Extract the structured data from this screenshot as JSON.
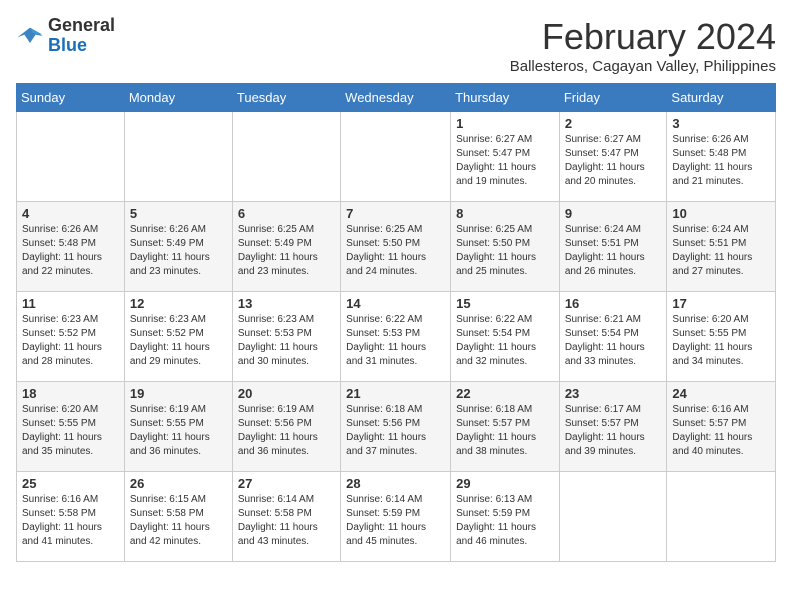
{
  "header": {
    "logo_general": "General",
    "logo_blue": "Blue",
    "title": "February 2024",
    "subtitle": "Ballesteros, Cagayan Valley, Philippines"
  },
  "weekdays": [
    "Sunday",
    "Monday",
    "Tuesday",
    "Wednesday",
    "Thursday",
    "Friday",
    "Saturday"
  ],
  "weeks": [
    [
      {
        "day": "",
        "info": ""
      },
      {
        "day": "",
        "info": ""
      },
      {
        "day": "",
        "info": ""
      },
      {
        "day": "",
        "info": ""
      },
      {
        "day": "1",
        "info": "Sunrise: 6:27 AM\nSunset: 5:47 PM\nDaylight: 11 hours and 19 minutes."
      },
      {
        "day": "2",
        "info": "Sunrise: 6:27 AM\nSunset: 5:47 PM\nDaylight: 11 hours and 20 minutes."
      },
      {
        "day": "3",
        "info": "Sunrise: 6:26 AM\nSunset: 5:48 PM\nDaylight: 11 hours and 21 minutes."
      }
    ],
    [
      {
        "day": "4",
        "info": "Sunrise: 6:26 AM\nSunset: 5:48 PM\nDaylight: 11 hours and 22 minutes."
      },
      {
        "day": "5",
        "info": "Sunrise: 6:26 AM\nSunset: 5:49 PM\nDaylight: 11 hours and 23 minutes."
      },
      {
        "day": "6",
        "info": "Sunrise: 6:25 AM\nSunset: 5:49 PM\nDaylight: 11 hours and 23 minutes."
      },
      {
        "day": "7",
        "info": "Sunrise: 6:25 AM\nSunset: 5:50 PM\nDaylight: 11 hours and 24 minutes."
      },
      {
        "day": "8",
        "info": "Sunrise: 6:25 AM\nSunset: 5:50 PM\nDaylight: 11 hours and 25 minutes."
      },
      {
        "day": "9",
        "info": "Sunrise: 6:24 AM\nSunset: 5:51 PM\nDaylight: 11 hours and 26 minutes."
      },
      {
        "day": "10",
        "info": "Sunrise: 6:24 AM\nSunset: 5:51 PM\nDaylight: 11 hours and 27 minutes."
      }
    ],
    [
      {
        "day": "11",
        "info": "Sunrise: 6:23 AM\nSunset: 5:52 PM\nDaylight: 11 hours and 28 minutes."
      },
      {
        "day": "12",
        "info": "Sunrise: 6:23 AM\nSunset: 5:52 PM\nDaylight: 11 hours and 29 minutes."
      },
      {
        "day": "13",
        "info": "Sunrise: 6:23 AM\nSunset: 5:53 PM\nDaylight: 11 hours and 30 minutes."
      },
      {
        "day": "14",
        "info": "Sunrise: 6:22 AM\nSunset: 5:53 PM\nDaylight: 11 hours and 31 minutes."
      },
      {
        "day": "15",
        "info": "Sunrise: 6:22 AM\nSunset: 5:54 PM\nDaylight: 11 hours and 32 minutes."
      },
      {
        "day": "16",
        "info": "Sunrise: 6:21 AM\nSunset: 5:54 PM\nDaylight: 11 hours and 33 minutes."
      },
      {
        "day": "17",
        "info": "Sunrise: 6:20 AM\nSunset: 5:55 PM\nDaylight: 11 hours and 34 minutes."
      }
    ],
    [
      {
        "day": "18",
        "info": "Sunrise: 6:20 AM\nSunset: 5:55 PM\nDaylight: 11 hours and 35 minutes."
      },
      {
        "day": "19",
        "info": "Sunrise: 6:19 AM\nSunset: 5:55 PM\nDaylight: 11 hours and 36 minutes."
      },
      {
        "day": "20",
        "info": "Sunrise: 6:19 AM\nSunset: 5:56 PM\nDaylight: 11 hours and 36 minutes."
      },
      {
        "day": "21",
        "info": "Sunrise: 6:18 AM\nSunset: 5:56 PM\nDaylight: 11 hours and 37 minutes."
      },
      {
        "day": "22",
        "info": "Sunrise: 6:18 AM\nSunset: 5:57 PM\nDaylight: 11 hours and 38 minutes."
      },
      {
        "day": "23",
        "info": "Sunrise: 6:17 AM\nSunset: 5:57 PM\nDaylight: 11 hours and 39 minutes."
      },
      {
        "day": "24",
        "info": "Sunrise: 6:16 AM\nSunset: 5:57 PM\nDaylight: 11 hours and 40 minutes."
      }
    ],
    [
      {
        "day": "25",
        "info": "Sunrise: 6:16 AM\nSunset: 5:58 PM\nDaylight: 11 hours and 41 minutes."
      },
      {
        "day": "26",
        "info": "Sunrise: 6:15 AM\nSunset: 5:58 PM\nDaylight: 11 hours and 42 minutes."
      },
      {
        "day": "27",
        "info": "Sunrise: 6:14 AM\nSunset: 5:58 PM\nDaylight: 11 hours and 43 minutes."
      },
      {
        "day": "28",
        "info": "Sunrise: 6:14 AM\nSunset: 5:59 PM\nDaylight: 11 hours and 45 minutes."
      },
      {
        "day": "29",
        "info": "Sunrise: 6:13 AM\nSunset: 5:59 PM\nDaylight: 11 hours and 46 minutes."
      },
      {
        "day": "",
        "info": ""
      },
      {
        "day": "",
        "info": ""
      }
    ]
  ],
  "colors": {
    "header_bg": "#3a7abf",
    "alt_row": "#f5f5f5"
  }
}
